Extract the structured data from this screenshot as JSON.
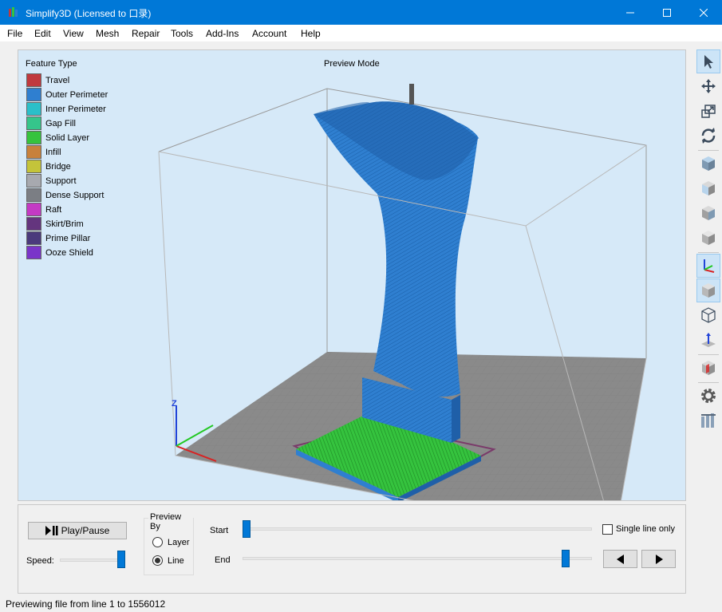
{
  "window": {
    "title": "Simplify3D (Licensed to 口录)",
    "app_icon": "simplify3d-logo-icon",
    "controls": [
      "minimize-icon",
      "maximize-icon",
      "close-icon"
    ]
  },
  "menu": [
    "File",
    "Edit",
    "View",
    "Mesh",
    "Repair",
    "Tools",
    "Add-Ins",
    "Account",
    "Help"
  ],
  "viewport": {
    "legend_title": "Feature Type",
    "mode_label": "Preview Mode",
    "legend": [
      {
        "label": "Travel",
        "color": "#c0393e"
      },
      {
        "label": "Outer Perimeter",
        "color": "#2f7fd0"
      },
      {
        "label": "Inner Perimeter",
        "color": "#2bbfc9"
      },
      {
        "label": "Gap Fill",
        "color": "#35c58b"
      },
      {
        "label": "Solid Layer",
        "color": "#35c33e"
      },
      {
        "label": "Infill",
        "color": "#c8813c"
      },
      {
        "label": "Bridge",
        "color": "#c4c43a"
      },
      {
        "label": "Support",
        "color": "#a7a9af"
      },
      {
        "label": "Dense Support",
        "color": "#7b7e84"
      },
      {
        "label": "Raft",
        "color": "#c43ac4"
      },
      {
        "label": "Skirt/Brim",
        "color": "#64357e"
      },
      {
        "label": "Prime Pillar",
        "color": "#4a3a7c"
      },
      {
        "label": "Ooze Shield",
        "color": "#7a35c9"
      }
    ],
    "axis_z_label": "Z"
  },
  "toolbar": [
    "select-arrow-icon",
    "move-icon",
    "scale-icon",
    "rotate-icon",
    "cube-top-view-icon",
    "cube-front-view-icon",
    "cube-side-view-icon",
    "cube-iso-view-icon",
    "axes-toggle-icon",
    "solid-cube-icon",
    "wireframe-cube-icon",
    "normals-icon",
    "cross-section-icon",
    "settings-gear-icon",
    "support-pillars-icon"
  ],
  "controls": {
    "play_label": "Play/Pause",
    "speed_label": "Speed:",
    "speed_value": 1.0,
    "preview_by_label": "Preview By",
    "options": [
      "Layer",
      "Line"
    ],
    "selected_option": "Line",
    "start_label": "Start",
    "end_label": "End",
    "start_value": 0.0,
    "end_value": 0.935,
    "single_line_label": "Single line only",
    "single_line_checked": false
  },
  "status": "Previewing file from line 1 to 1556012",
  "colors": {
    "titlebar": "#0078d7",
    "viewport_bg": "#d6e9f8",
    "accent": "#0078d7"
  }
}
